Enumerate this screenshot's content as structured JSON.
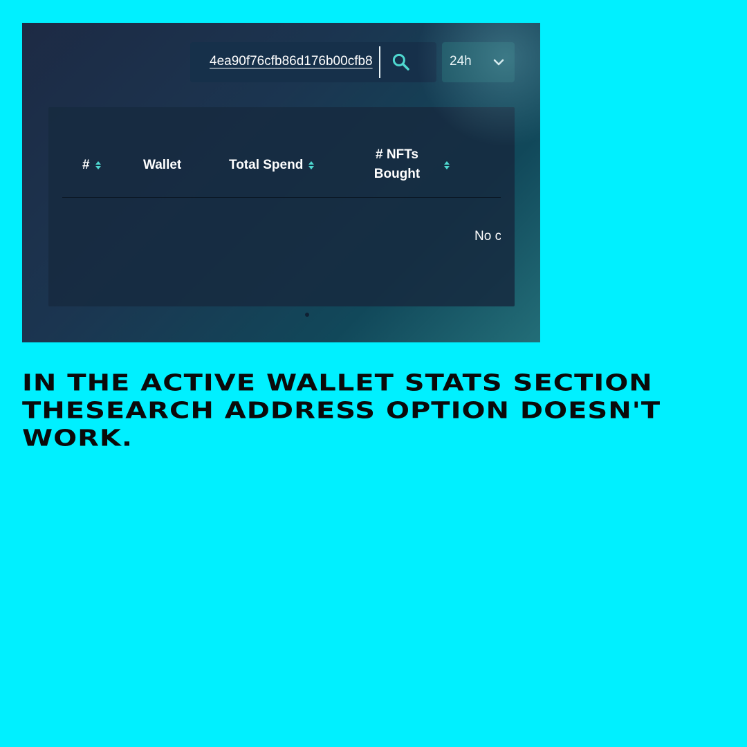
{
  "search": {
    "value": "4ea90f76cfb86d176b00cfb8",
    "icon": "search-icon"
  },
  "period": {
    "selected": "24h",
    "icon": "chevron-down-icon"
  },
  "table": {
    "columns": [
      {
        "label": "#",
        "sortable": true
      },
      {
        "label": "Wallet",
        "sortable": false
      },
      {
        "label": "Total Spend",
        "sortable": true
      },
      {
        "label": "# NFTs Bought",
        "sortable": true
      }
    ],
    "empty_text": "No c"
  },
  "caption": "IN THE ACTIVE WALLET STATS SECTION THESEARCH ADDRESS OPTION DOESN'T WORK.",
  "colors": {
    "background": "#00f0ff",
    "accent": "#4fd8d0",
    "panel": "#16304a"
  }
}
